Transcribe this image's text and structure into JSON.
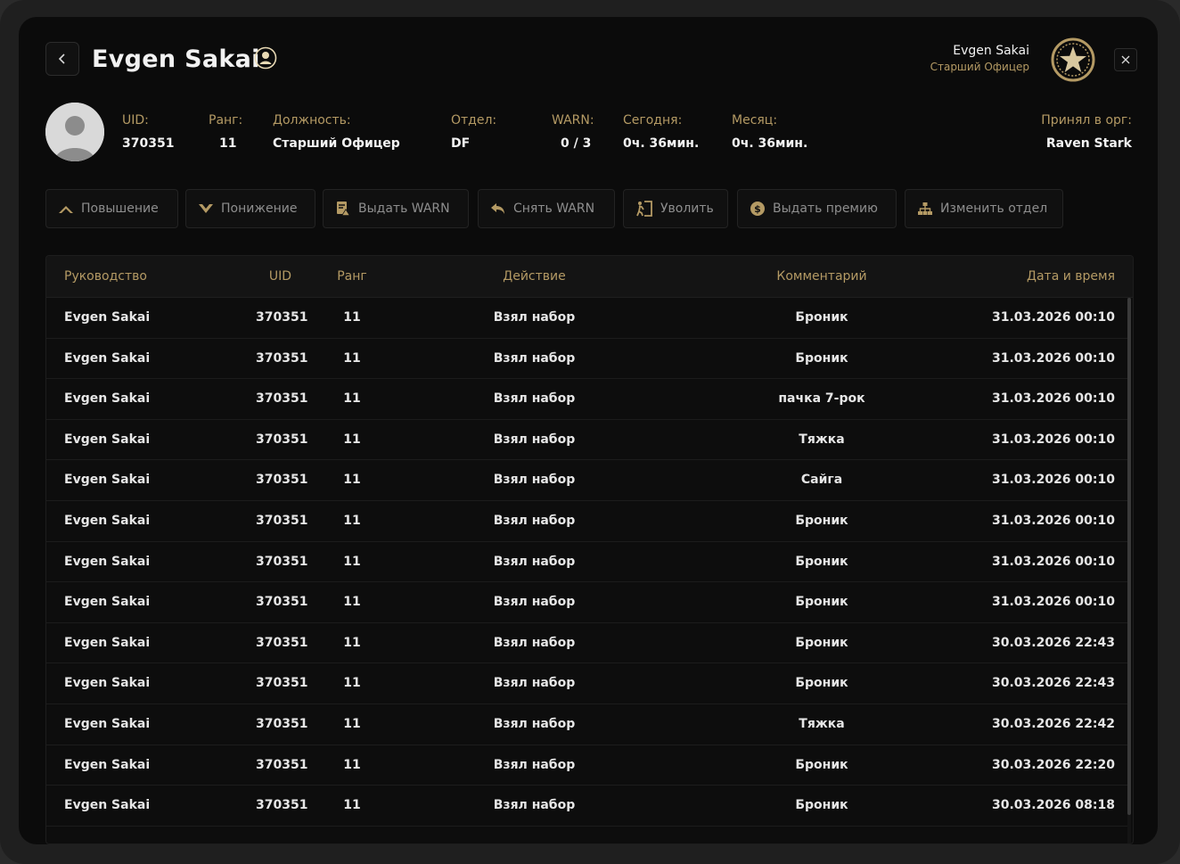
{
  "header": {
    "title": "Evgen Sakai",
    "user_name": "Evgen Sakai",
    "user_role": "Старший Офицер",
    "icons": {
      "back": "chevron-left-icon",
      "profile": "user-circle-icon",
      "badge": "star-badge-icon",
      "close": "close-icon"
    }
  },
  "info": {
    "uid": {
      "label": "UID:",
      "value": "370351"
    },
    "rank": {
      "label": "Ранг:",
      "value": "11"
    },
    "position": {
      "label": "Должность:",
      "value": "Старший Офицер"
    },
    "department": {
      "label": "Отдел:",
      "value": "DF"
    },
    "warn": {
      "label": "WARN:",
      "value": "0 / 3"
    },
    "today": {
      "label": "Сегодня:",
      "value": "0ч. 36мин."
    },
    "month": {
      "label": "Месяц:",
      "value": "0ч. 36мин."
    },
    "accepted": {
      "label": "Принял в орг:",
      "value": "Raven Stark"
    }
  },
  "actions": [
    {
      "label": "Повышение",
      "icon": "chevron-up-icon"
    },
    {
      "label": "Понижение",
      "icon": "chevron-down-icon"
    },
    {
      "label": "Выдать WARN",
      "icon": "warn-doc-icon"
    },
    {
      "label": "Снять WARN",
      "icon": "undo-icon"
    },
    {
      "label": "Уволить",
      "icon": "door-exit-icon"
    },
    {
      "label": "Выдать премию",
      "icon": "coin-icon"
    },
    {
      "label": "Изменить отдел",
      "icon": "org-chart-icon"
    }
  ],
  "table": {
    "columns": [
      "Руководство",
      "UID",
      "Ранг",
      "Действие",
      "Комментарий",
      "Дата и время"
    ],
    "rows": [
      [
        "Evgen Sakai",
        "370351",
        "11",
        "Взял набор",
        "Броник",
        "31.03.2026 00:10"
      ],
      [
        "Evgen Sakai",
        "370351",
        "11",
        "Взял набор",
        "Броник",
        "31.03.2026 00:10"
      ],
      [
        "Evgen Sakai",
        "370351",
        "11",
        "Взял набор",
        "пачка 7-рок",
        "31.03.2026 00:10"
      ],
      [
        "Evgen Sakai",
        "370351",
        "11",
        "Взял набор",
        "Тяжка",
        "31.03.2026 00:10"
      ],
      [
        "Evgen Sakai",
        "370351",
        "11",
        "Взял набор",
        "Сайга",
        "31.03.2026 00:10"
      ],
      [
        "Evgen Sakai",
        "370351",
        "11",
        "Взял набор",
        "Броник",
        "31.03.2026 00:10"
      ],
      [
        "Evgen Sakai",
        "370351",
        "11",
        "Взял набор",
        "Броник",
        "31.03.2026 00:10"
      ],
      [
        "Evgen Sakai",
        "370351",
        "11",
        "Взял набор",
        "Броник",
        "31.03.2026 00:10"
      ],
      [
        "Evgen Sakai",
        "370351",
        "11",
        "Взял набор",
        "Броник",
        "30.03.2026 22:43"
      ],
      [
        "Evgen Sakai",
        "370351",
        "11",
        "Взял набор",
        "Броник",
        "30.03.2026 22:43"
      ],
      [
        "Evgen Sakai",
        "370351",
        "11",
        "Взял набор",
        "Тяжка",
        "30.03.2026 22:42"
      ],
      [
        "Evgen Sakai",
        "370351",
        "11",
        "Взял набор",
        "Броник",
        "30.03.2026 22:20"
      ],
      [
        "Evgen Sakai",
        "370351",
        "11",
        "Взял набор",
        "Броник",
        "30.03.2026 08:18"
      ]
    ]
  },
  "colors": {
    "accent": "#b49a64",
    "background": "#0b0b0b",
    "text": "#f2f2f2"
  }
}
